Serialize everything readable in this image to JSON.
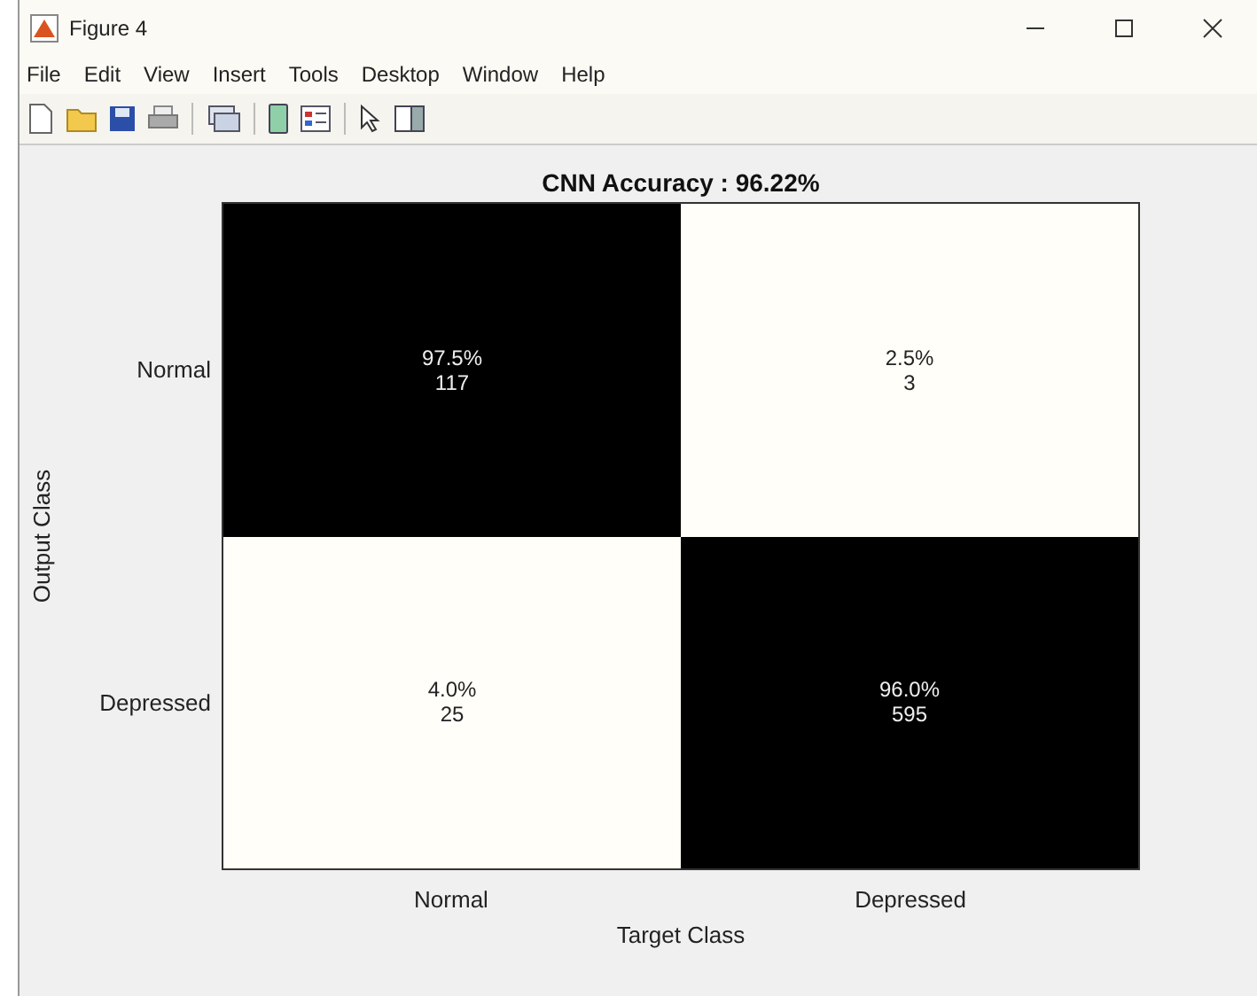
{
  "window": {
    "title": "Figure 4"
  },
  "menu": [
    "File",
    "Edit",
    "View",
    "Insert",
    "Tools",
    "Desktop",
    "Window",
    "Help"
  ],
  "toolbar": [
    {
      "kind": "new"
    },
    {
      "kind": "open"
    },
    {
      "kind": "save"
    },
    {
      "kind": "print"
    },
    {
      "kind": "sep"
    },
    {
      "kind": "link"
    },
    {
      "kind": "sep"
    },
    {
      "kind": "rect"
    },
    {
      "kind": "legend"
    },
    {
      "kind": "sep"
    },
    {
      "kind": "pointer"
    },
    {
      "kind": "panel"
    }
  ],
  "plot": {
    "title": "CNN Accuracy :  96.22%",
    "ylabel": "Output Class",
    "xlabel": "Target Class",
    "row_labels": [
      "Normal",
      "Depressed"
    ],
    "column_labels": [
      "Normal",
      "Depressed"
    ],
    "cells": [
      [
        {
          "percent": "97.5%",
          "count": "117",
          "kind": "dark"
        },
        {
          "percent": "2.5%",
          "count": "3",
          "kind": "light"
        }
      ],
      [
        {
          "percent": "4.0%",
          "count": "25",
          "kind": "light"
        },
        {
          "percent": "96.0%",
          "count": "595",
          "kind": "dark"
        }
      ]
    ]
  }
}
